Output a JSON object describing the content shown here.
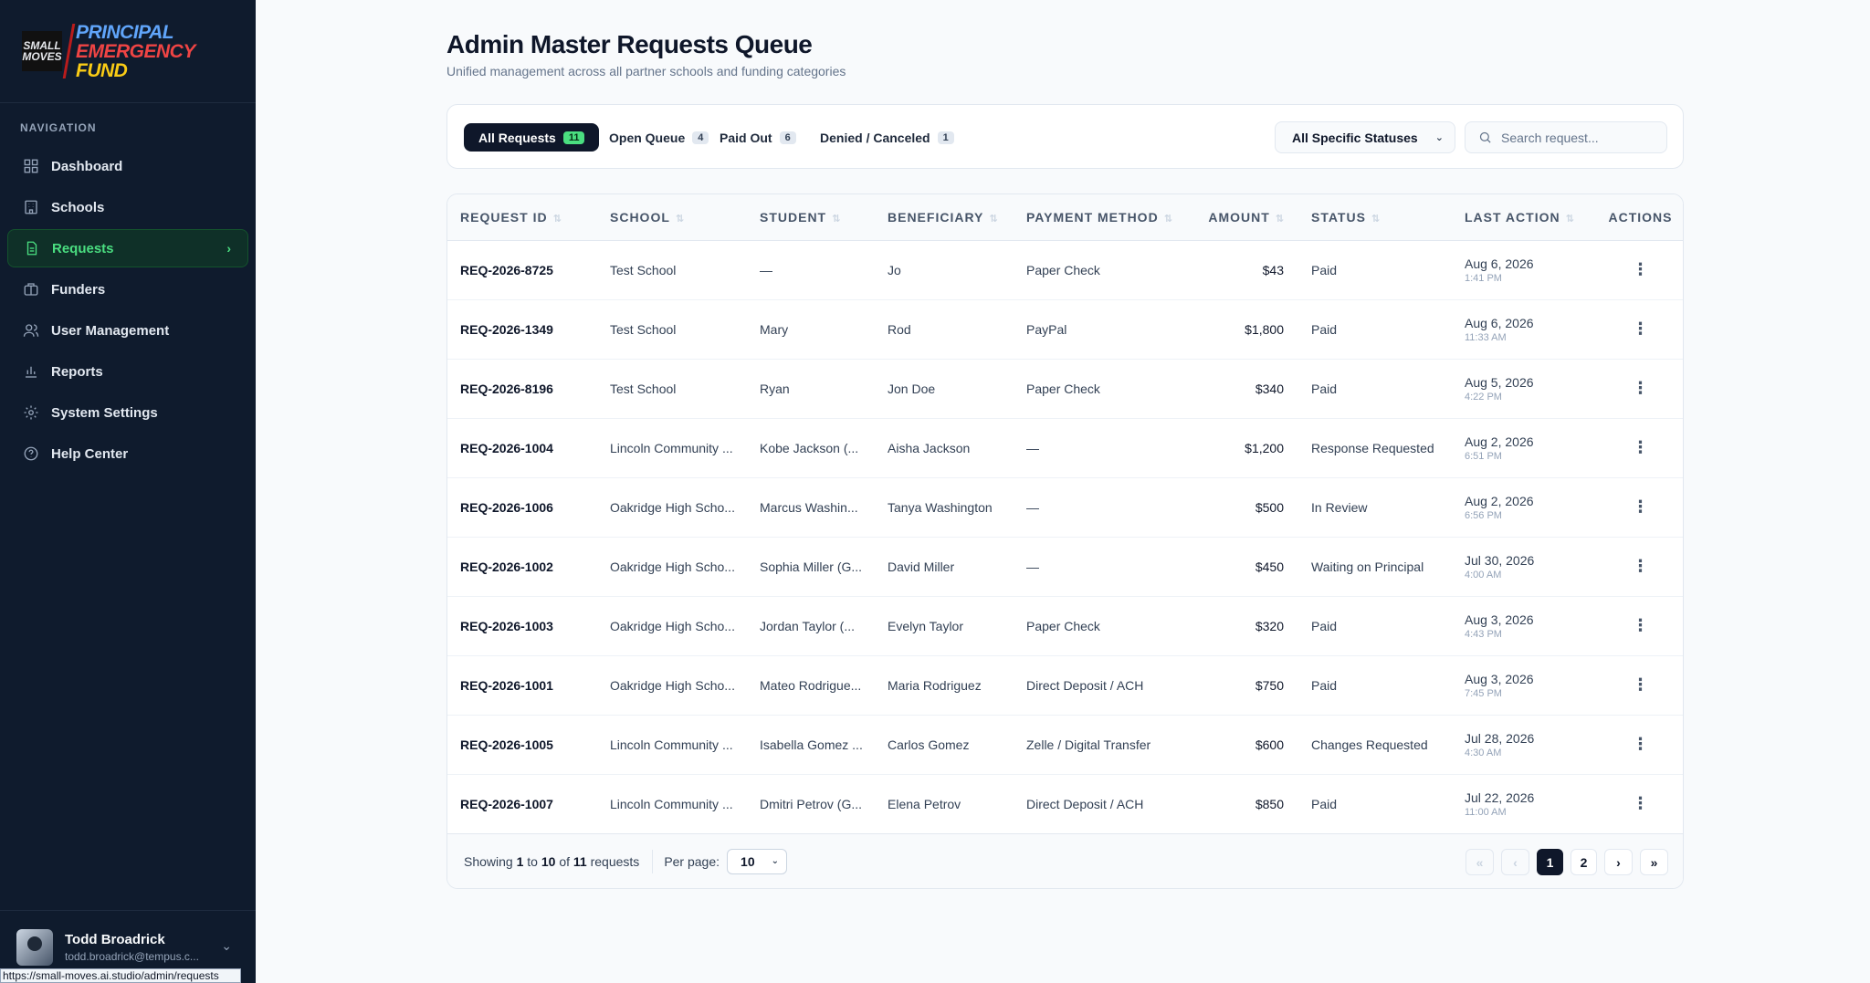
{
  "brand": {
    "logo_box_line1": "SMALL",
    "logo_box_line2": "MOVES",
    "line1": "PRINCIPAL",
    "line2": "EMERGENCY",
    "line3": "FUND"
  },
  "sidebar": {
    "section_title": "NAVIGATION",
    "items": [
      {
        "label": "Dashboard",
        "icon": "grid-icon"
      },
      {
        "label": "Schools",
        "icon": "building-icon"
      },
      {
        "label": "Requests",
        "icon": "document-icon",
        "active": true
      },
      {
        "label": "Funders",
        "icon": "briefcase-icon"
      },
      {
        "label": "User Management",
        "icon": "users-icon"
      },
      {
        "label": "Reports",
        "icon": "bar-chart-icon"
      },
      {
        "label": "System Settings",
        "icon": "gear-icon"
      },
      {
        "label": "Help Center",
        "icon": "help-circle-icon"
      }
    ]
  },
  "user": {
    "name": "Todd Broadrick",
    "email": "todd.broadrick@tempus.c..."
  },
  "status_url": "https://small-moves.ai.studio/admin/requests",
  "page": {
    "title": "Admin Master Requests Queue",
    "subtitle": "Unified management across all partner schools and funding categories"
  },
  "filters": {
    "tabs": [
      {
        "label": "All Requests",
        "count": "11"
      },
      {
        "label": "Open Queue",
        "count": "4"
      },
      {
        "label": "Paid Out",
        "count": "6"
      },
      {
        "label": "Denied / Canceled",
        "count": "1"
      }
    ],
    "status_select": "All Specific Statuses",
    "search_placeholder": "Search request..."
  },
  "table": {
    "headers": [
      "REQUEST ID",
      "SCHOOL",
      "STUDENT",
      "BENEFICIARY",
      "PAYMENT METHOD",
      "AMOUNT",
      "STATUS",
      "LAST ACTION",
      "ACTIONS"
    ],
    "rows": [
      {
        "id": "REQ-2026-8725",
        "school": "Test School",
        "student": "—",
        "beneficiary": "Jo",
        "payment": "Paper Check",
        "amount": "$43",
        "status": "Paid",
        "date": "Aug 6, 2026",
        "time": "1:41 PM"
      },
      {
        "id": "REQ-2026-1349",
        "school": "Test School",
        "student": "Mary",
        "beneficiary": "Rod",
        "payment": "PayPal",
        "amount": "$1,800",
        "status": "Paid",
        "date": "Aug 6, 2026",
        "time": "11:33 AM"
      },
      {
        "id": "REQ-2026-8196",
        "school": "Test School",
        "student": "Ryan",
        "beneficiary": "Jon Doe",
        "payment": "Paper Check",
        "amount": "$340",
        "status": "Paid",
        "date": "Aug 5, 2026",
        "time": "4:22 PM"
      },
      {
        "id": "REQ-2026-1004",
        "school": "Lincoln Community ...",
        "student": "Kobe Jackson (...",
        "beneficiary": "Aisha Jackson",
        "payment": "—",
        "amount": "$1,200",
        "status": "Response Requested",
        "date": "Aug 2, 2026",
        "time": "6:51 PM"
      },
      {
        "id": "REQ-2026-1006",
        "school": "Oakridge High Scho...",
        "student": "Marcus Washin...",
        "beneficiary": "Tanya Washington",
        "payment": "—",
        "amount": "$500",
        "status": "In Review",
        "date": "Aug 2, 2026",
        "time": "6:56 PM"
      },
      {
        "id": "REQ-2026-1002",
        "school": "Oakridge High Scho...",
        "student": "Sophia Miller (G...",
        "beneficiary": "David Miller",
        "payment": "—",
        "amount": "$450",
        "status": "Waiting on Principal",
        "date": "Jul 30, 2026",
        "time": "4:00 AM"
      },
      {
        "id": "REQ-2026-1003",
        "school": "Oakridge High Scho...",
        "student": "Jordan Taylor (...",
        "beneficiary": "Evelyn Taylor",
        "payment": "Paper Check",
        "amount": "$320",
        "status": "Paid",
        "date": "Aug 3, 2026",
        "time": "4:43 PM"
      },
      {
        "id": "REQ-2026-1001",
        "school": "Oakridge High Scho...",
        "student": "Mateo Rodrigue...",
        "beneficiary": "Maria Rodriguez",
        "payment": "Direct Deposit / ACH",
        "amount": "$750",
        "status": "Paid",
        "date": "Aug 3, 2026",
        "time": "7:45 PM"
      },
      {
        "id": "REQ-2026-1005",
        "school": "Lincoln Community ...",
        "student": "Isabella Gomez ...",
        "beneficiary": "Carlos Gomez",
        "payment": "Zelle / Digital Transfer",
        "amount": "$600",
        "status": "Changes Requested",
        "date": "Jul 28, 2026",
        "time": "4:30 AM"
      },
      {
        "id": "REQ-2026-1007",
        "school": "Lincoln Community ...",
        "student": "Dmitri Petrov (G...",
        "beneficiary": "Elena Petrov",
        "payment": "Direct Deposit / ACH",
        "amount": "$850",
        "status": "Paid",
        "date": "Jul 22, 2026",
        "time": "11:00 AM"
      }
    ]
  },
  "footer": {
    "showing_prefix": "Showing",
    "from": "1",
    "to_word": "to",
    "to": "10",
    "of_word": "of",
    "total": "11",
    "suffix": "requests",
    "per_page_label": "Per page:",
    "per_page_value": "10",
    "pages": [
      "1",
      "2"
    ],
    "current_page": "1"
  }
}
